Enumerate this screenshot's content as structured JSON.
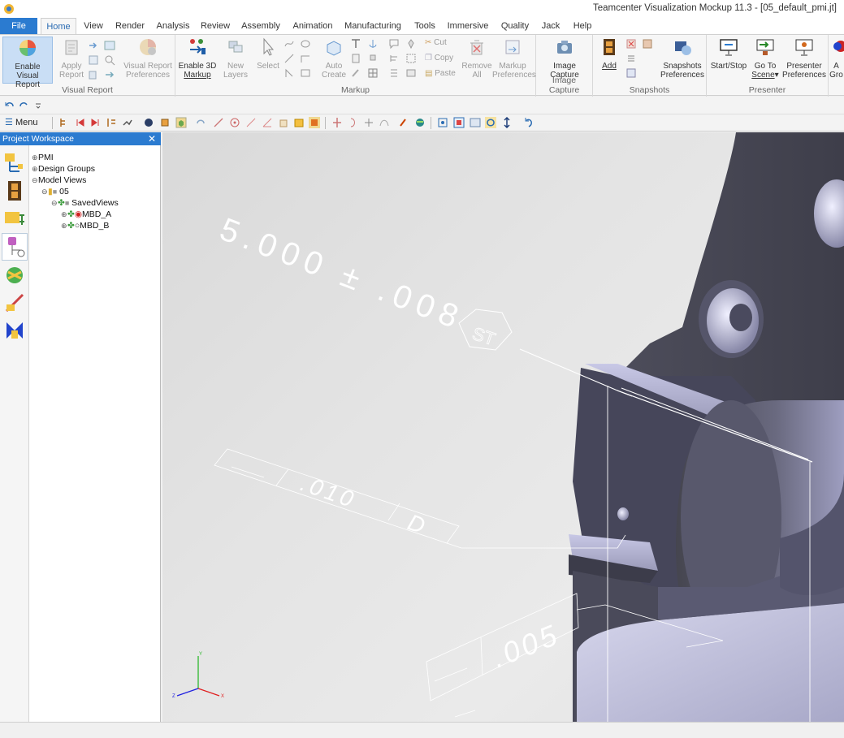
{
  "window": {
    "title": "Teamcenter Visualization Mockup 11.3 - [05_default_pmi.jt]"
  },
  "tabs": [
    {
      "label": "File"
    },
    {
      "label": "Home"
    },
    {
      "label": "View"
    },
    {
      "label": "Render"
    },
    {
      "label": "Analysis"
    },
    {
      "label": "Review"
    },
    {
      "label": "Assembly"
    },
    {
      "label": "Animation"
    },
    {
      "label": "Manufacturing"
    },
    {
      "label": "Tools"
    },
    {
      "label": "Immersive"
    },
    {
      "label": "Quality"
    },
    {
      "label": "Jack"
    },
    {
      "label": "Help"
    }
  ],
  "ribbon": {
    "visual_report": {
      "group_label": "Visual Report",
      "enable_line1": "Enable Visual",
      "enable_line2": "Report",
      "apply_line1": "Apply",
      "apply_line2": "Report",
      "prefs_line1": "Visual Report",
      "prefs_line2": "Preferences"
    },
    "markup": {
      "group_label": "Markup",
      "enable3d_line1": "Enable 3D",
      "enable3d_line2": "Markup",
      "newlayers_line1": "New",
      "newlayers_line2": "Layers",
      "select": "Select",
      "auto_line1": "Auto",
      "auto_line2": "Create",
      "cut": "Cut",
      "copy": "Copy",
      "paste": "Paste",
      "remove_line1": "Remove",
      "remove_line2": "All",
      "prefs_line1": "Markup",
      "prefs_line2": "Preferences"
    },
    "image_capture": {
      "group_label": "Image Capture",
      "btn_line1": "Image",
      "btn_line2": "Capture"
    },
    "snapshots": {
      "group_label": "Snapshots",
      "add": "Add",
      "prefs_line1": "Snapshots",
      "prefs_line2": "Preferences"
    },
    "presenter": {
      "group_label": "Presenter",
      "startstop": "Start/Stop",
      "goto_line1": "Go To",
      "goto_line2": "Scene",
      "prefs_line1": "Presenter",
      "prefs_line2": "Preferences"
    },
    "overflow_line1": "A",
    "overflow_line2": "Gro"
  },
  "toolbar": {
    "menu_label": "Menu"
  },
  "workspace": {
    "title": "Project Workspace",
    "tree": [
      {
        "label": "PMI"
      },
      {
        "label": "Design Groups"
      },
      {
        "label": "Model Views"
      },
      {
        "label": "05"
      },
      {
        "label": "SavedViews"
      },
      {
        "label": "MBD_A"
      },
      {
        "label": "MBD_B"
      }
    ]
  },
  "pmi": {
    "dimension": "5.000 ± .008",
    "st_symbol": "ST",
    "tolerance_1": ".010",
    "datum_1": "D",
    "tolerance_2": ".005"
  },
  "triad": {
    "x": "X",
    "y": "Y",
    "z": "Z"
  },
  "colors": {
    "accent": "#2b7bd0",
    "model_dark": "#4a4a58",
    "model_light": "#b9b9d8",
    "pmi_text": "#ffffff"
  }
}
